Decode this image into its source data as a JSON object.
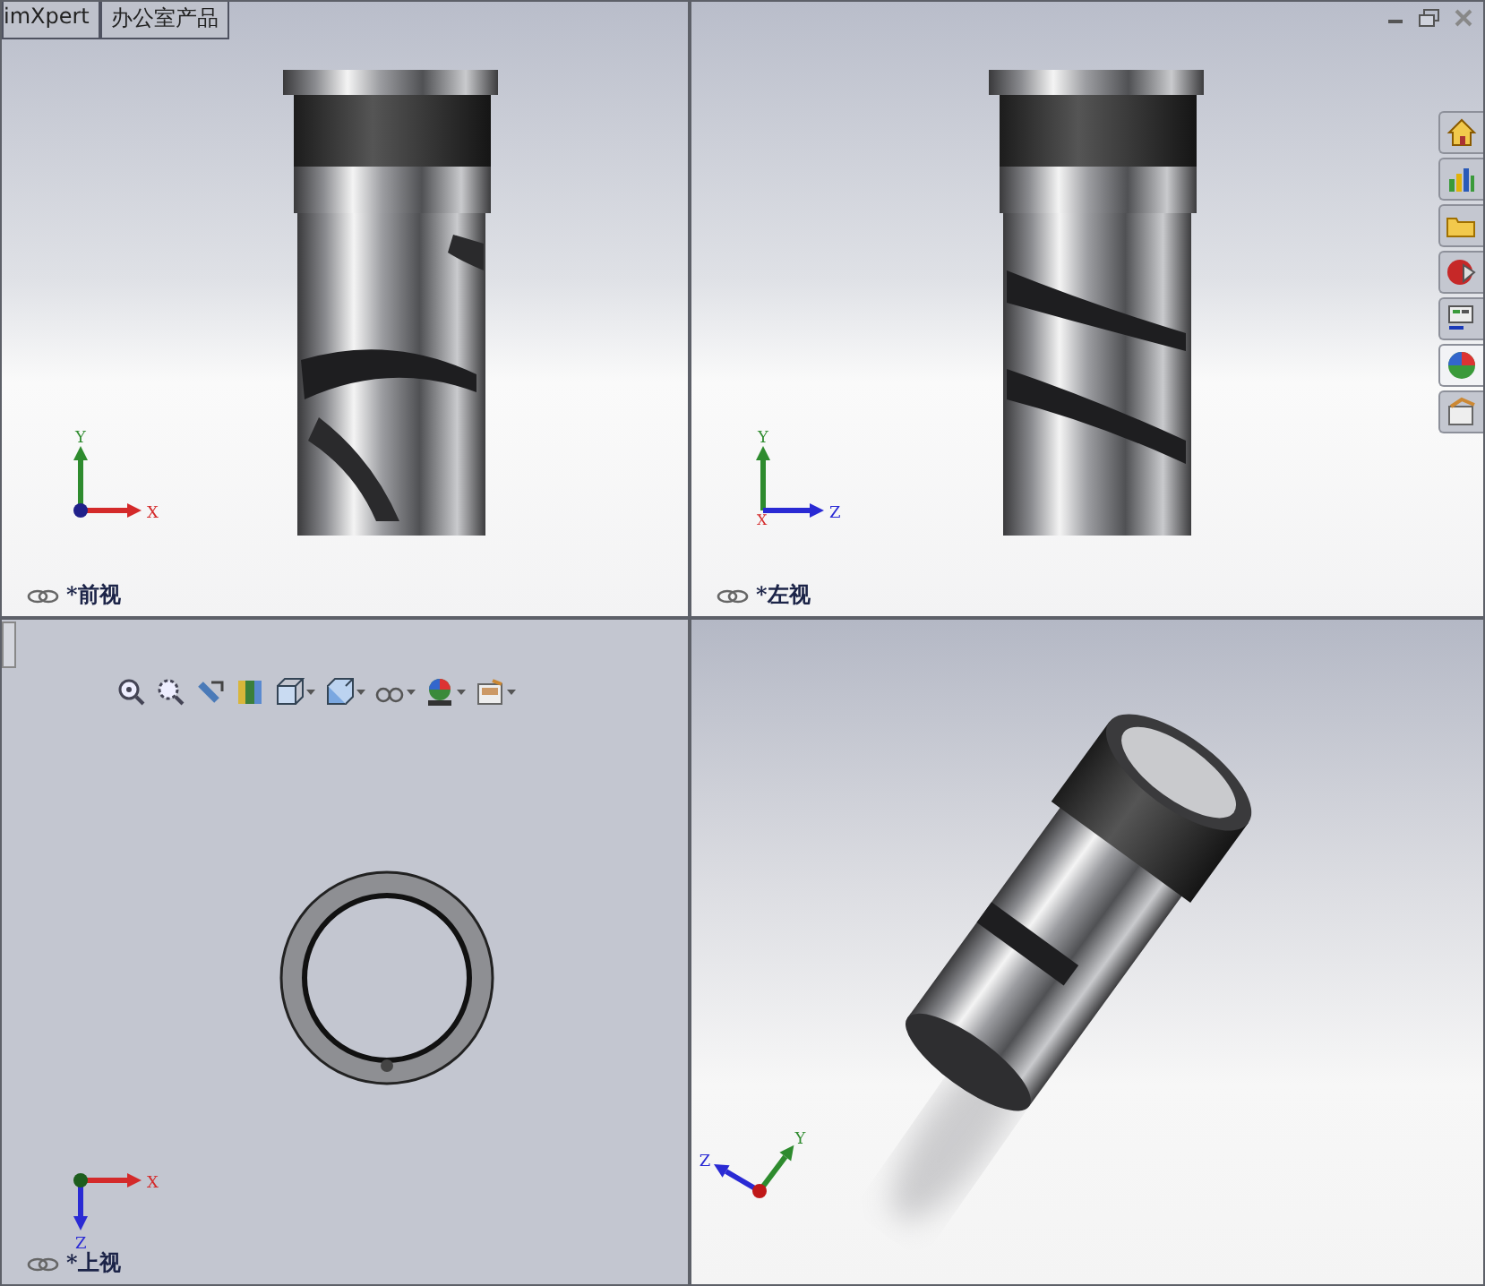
{
  "tabs": [
    {
      "label": "imXpert",
      "selected": false
    },
    {
      "label": "办公室产品",
      "selected": false
    }
  ],
  "task_pane": [
    {
      "selected": false
    },
    {
      "selected": false
    },
    {
      "selected": false
    },
    {
      "selected": false
    },
    {
      "selected": false
    },
    {
      "selected": true
    },
    {
      "selected": false
    }
  ],
  "viewports": [
    {
      "kind": "front",
      "label": "*前视",
      "axes": [
        {
          "label": "Y",
          "kind": "up",
          "color": "#2e8b2e"
        },
        {
          "label": "X",
          "kind": "right",
          "color": "#d42a2a"
        }
      ]
    },
    {
      "kind": "left",
      "label": "*左视",
      "axes": [
        {
          "label": "Y",
          "kind": "up",
          "color": "#2e8b2e"
        },
        {
          "label": "X",
          "kind": "toward",
          "color": "#d42a2a"
        },
        {
          "label": "Z",
          "kind": "right",
          "color": "#2a2ad4"
        }
      ]
    },
    {
      "kind": "top",
      "label": "*上视",
      "axes": [
        {
          "label": "X",
          "kind": "right",
          "color": "#d42a2a"
        },
        {
          "label": "Z",
          "kind": "down",
          "color": "#2a2ad4"
        }
      ]
    },
    {
      "kind": "iso",
      "axes": [
        {
          "label": "Z",
          "kind": "upleft",
          "color": "#2a2ad4"
        },
        {
          "label": "Y",
          "kind": "upright",
          "color": "#2e8b2e"
        }
      ]
    }
  ],
  "toolbar": [
    {
      "has_menu": false
    },
    {
      "has_menu": false
    },
    {
      "has_menu": false
    },
    {
      "has_menu": false
    },
    {
      "has_menu": true
    },
    {
      "has_menu": true
    },
    {
      "has_menu": true
    },
    {
      "has_menu": true
    },
    {
      "has_menu": true
    }
  ]
}
